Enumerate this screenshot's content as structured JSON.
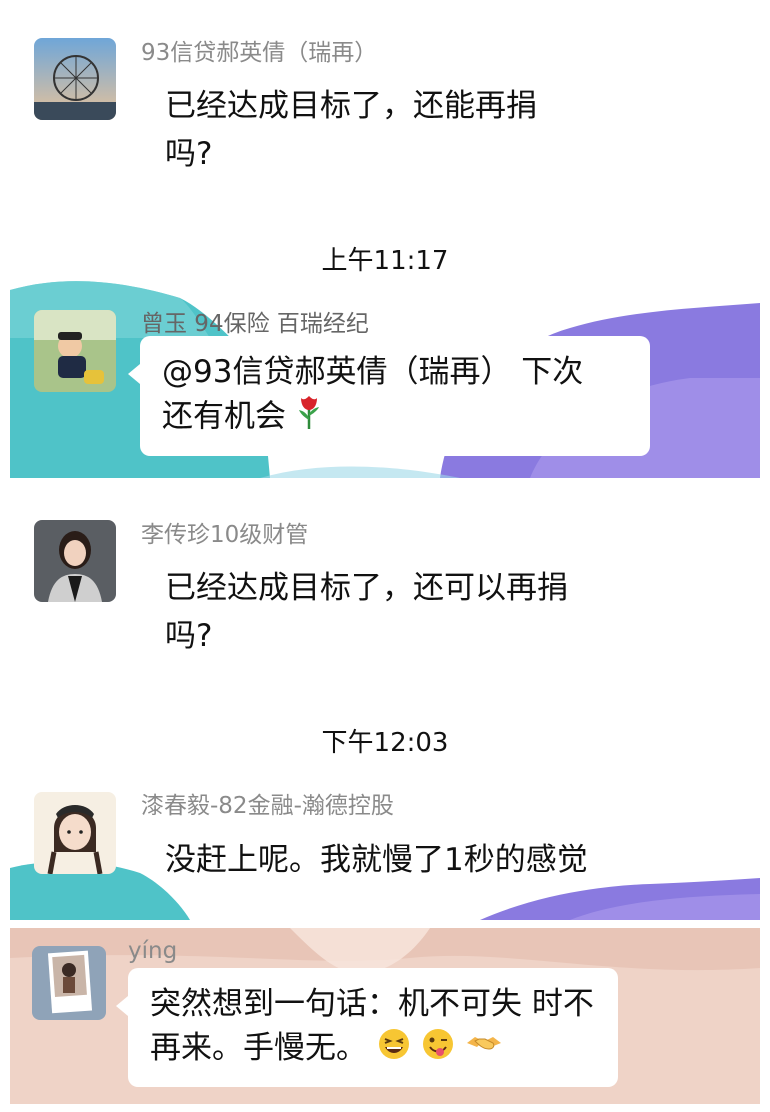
{
  "messages": [
    {
      "sender": "93信贷郝英倩（瑞再）",
      "text_line1": "已经达成目标了，还能再捐",
      "text_line2": "吗?"
    },
    {
      "time": "上午11:17",
      "sender": "曾玉 94保险 百瑞经纪",
      "text_line1": "@93信贷郝英倩（瑞再） 下次",
      "text_line2": "还有机会",
      "emoji": [
        "rose-icon"
      ]
    },
    {
      "sender": "李传珍10级财管",
      "text_line1": "已经达成目标了，还可以再捐",
      "text_line2": "吗?"
    },
    {
      "time": "下午12:03",
      "sender": "漆春毅-82金融-瀚德控股",
      "text_line1": "没赶上呢。我就慢了1秒的感觉"
    },
    {
      "sender": "yíng",
      "text_line1": "突然想到一句话：机不可失 时不",
      "text_line2": "再来。手慢无。",
      "emoji": [
        "grinning-squint-icon",
        "winking-tongue-icon",
        "handshake-icon"
      ]
    }
  ],
  "colors": {
    "teal": "#4fc3c8",
    "purple": "#8a7ae0",
    "peach": "#efd3c7"
  }
}
